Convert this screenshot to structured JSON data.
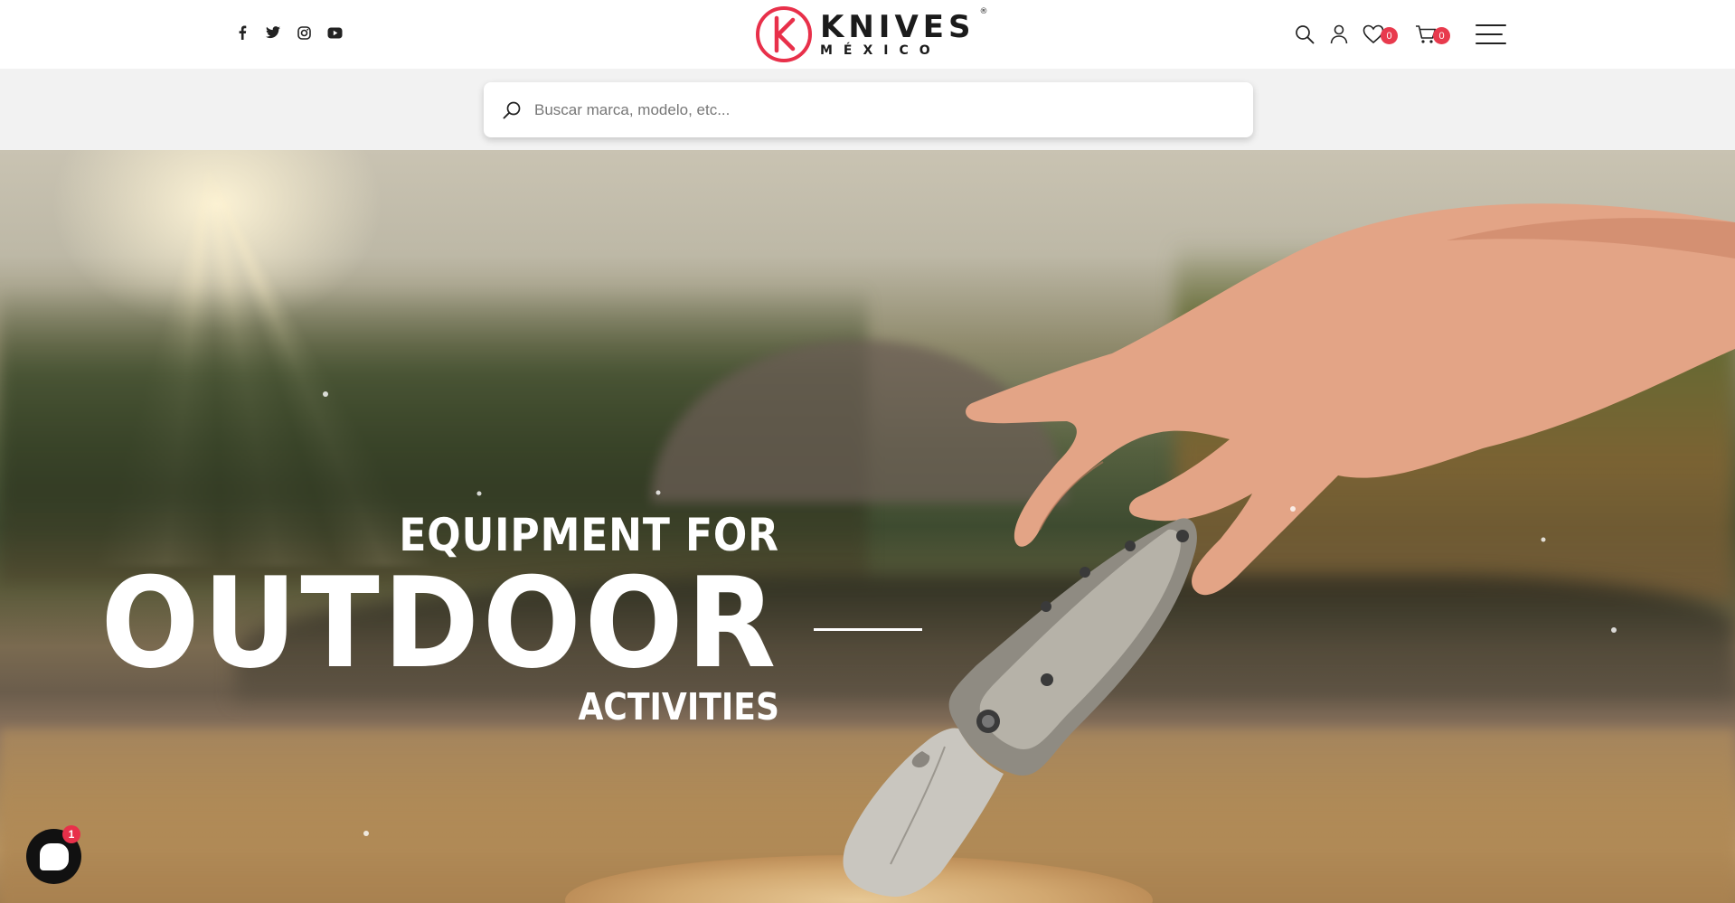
{
  "header": {
    "social": [
      {
        "name": "facebook-icon"
      },
      {
        "name": "twitter-icon"
      },
      {
        "name": "instagram-icon"
      },
      {
        "name": "youtube-icon"
      }
    ],
    "logo": {
      "main": "KNIVES",
      "sub": "MÉXICO",
      "registered": "®",
      "brand_color": "#e8304a"
    },
    "wishlist_count": "0",
    "cart_count": "0",
    "badge_color": "#e83a4d"
  },
  "search": {
    "placeholder": "Buscar marca, modelo, etc..."
  },
  "hero": {
    "line1": "EQUIPMENT FOR",
    "line2": "OUTDOOR",
    "line3": "ACTIVITIES"
  },
  "chat": {
    "badge_count": "1"
  }
}
